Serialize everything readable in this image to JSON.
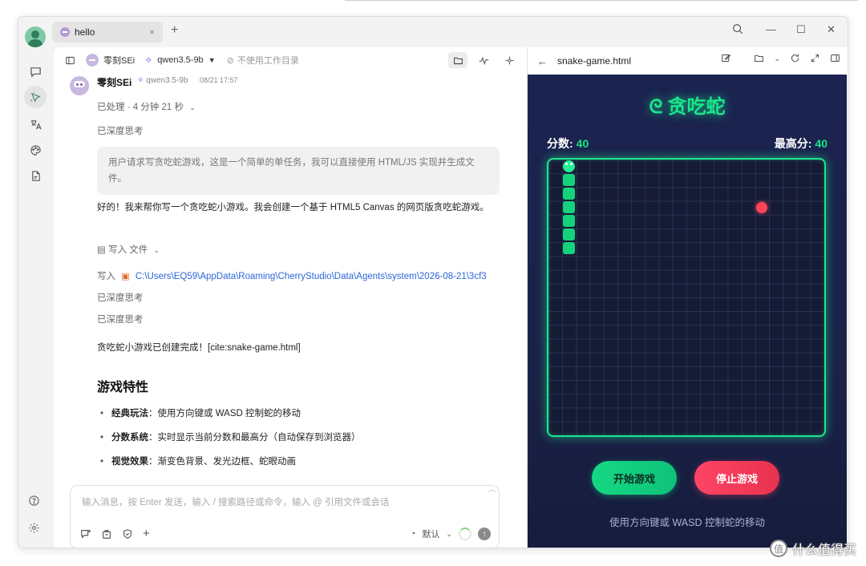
{
  "tab": {
    "title": "hello",
    "close": "×",
    "add": "+"
  },
  "window_controls": {
    "search": "⌕",
    "minimize": "—",
    "maximize": "☐",
    "close": "✕"
  },
  "chat_header": {
    "agent": "零刻SEi",
    "model": "qwen3.5-9b",
    "workspace": "不使用工作目录"
  },
  "message": {
    "author": "零刻SEi",
    "model": "qwen3.5-9b",
    "time": "08/21 17:57",
    "processed": "已处理 · 4 分钟 21 秒",
    "deep_think_1": "已深度思考",
    "thinking": "用户请求写贪吃蛇游戏，这是一个简单的单任务，我可以直接使用 HTML/JS 实现并生成文件。",
    "intro": "好的！我来帮你写一个贪吃蛇小游戏。我会创建一个基于 HTML5 Canvas 的网页版贪吃蛇游戏。",
    "write_file": "写入 文件",
    "write_label": "写入",
    "write_path": "C:\\Users\\EQ59\\AppData\\Roaming\\CherryStudio\\Data\\Agents\\system\\2026-08-21\\3cf3",
    "deep_think_2": "已深度思考",
    "deep_think_3": "已深度思考",
    "done": "贪吃蛇小游戏已创建完成！[cite:snake-game.html]",
    "heading": "游戏特性",
    "bullets": [
      {
        "label": "经典玩法",
        "text": "：使用方向键或 WASD 控制蛇的移动"
      },
      {
        "label": "分数系统",
        "text": "：实时显示当前分数和最高分（自动保存到浏览器）"
      },
      {
        "label": "视觉效果",
        "text": "：渐变色背景、发光边框、蛇眼动画"
      }
    ]
  },
  "input": {
    "placeholder": "输入消息，按 Enter 发送，输入 / 搜索路径或命令，输入 @ 引用文件或会话",
    "mode": "默认"
  },
  "preview": {
    "filename": "snake-game.html",
    "game_title": "贪吃蛇",
    "score_label": "分数:",
    "score": "40",
    "best_label": "最高分:",
    "best": "40",
    "start_button": "开始游戏",
    "stop_button": "停止游戏",
    "hint": "使用方向键或 WASD 控制蛇的移动"
  },
  "watermark": {
    "text": "什么值得买",
    "icon": "值"
  },
  "colors": {
    "accent_green": "#19e58a",
    "food_red": "#ff4458",
    "link_blue": "#2b67d9",
    "game_bg": "#1b2350"
  }
}
